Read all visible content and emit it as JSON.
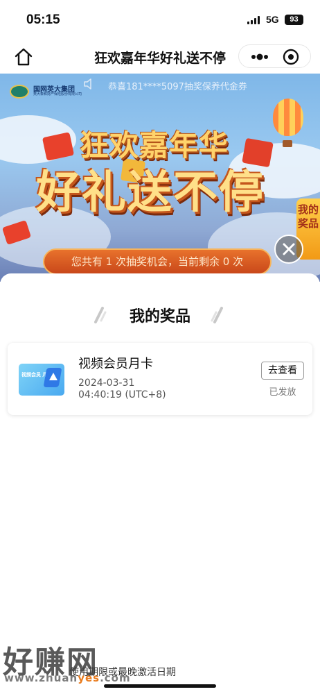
{
  "status_bar": {
    "time": "05:15",
    "network": "5G",
    "battery": "93"
  },
  "nav": {
    "title": "狂欢嘉年华好礼送不停"
  },
  "banner": {
    "company_name": "国网英大集团",
    "company_subtitle": "英大泰和财产保险股份有限公司",
    "marquee": "恭喜181****5097抽奖保养代金券",
    "headline_line1": "狂欢嘉年华",
    "headline_line2": "好礼送不停",
    "my_prizes_tab": "我的奖品",
    "chances_text": "您共有 1 次抽奖机会，当前剩余 0 次"
  },
  "sheet": {
    "title": "我的奖品",
    "prizes": [
      {
        "name": "视频会员月卡",
        "thumb_text": "视频会员 月卡",
        "date": "2024-03-31",
        "time": "04:40:19 (UTC+8)",
        "action_label": "去查看",
        "status": "已发放"
      }
    ],
    "footer_note": "使用期限或最晚激活日期"
  },
  "watermark": {
    "brand": "好赚网",
    "url_prefix": "www.zhuan",
    "url_accent": "yes",
    "url_suffix": ".com"
  },
  "colors": {
    "banner_sky": "#8fbfea",
    "pill_orange": "#d85a22",
    "headline_gold": "#ffd36b"
  }
}
